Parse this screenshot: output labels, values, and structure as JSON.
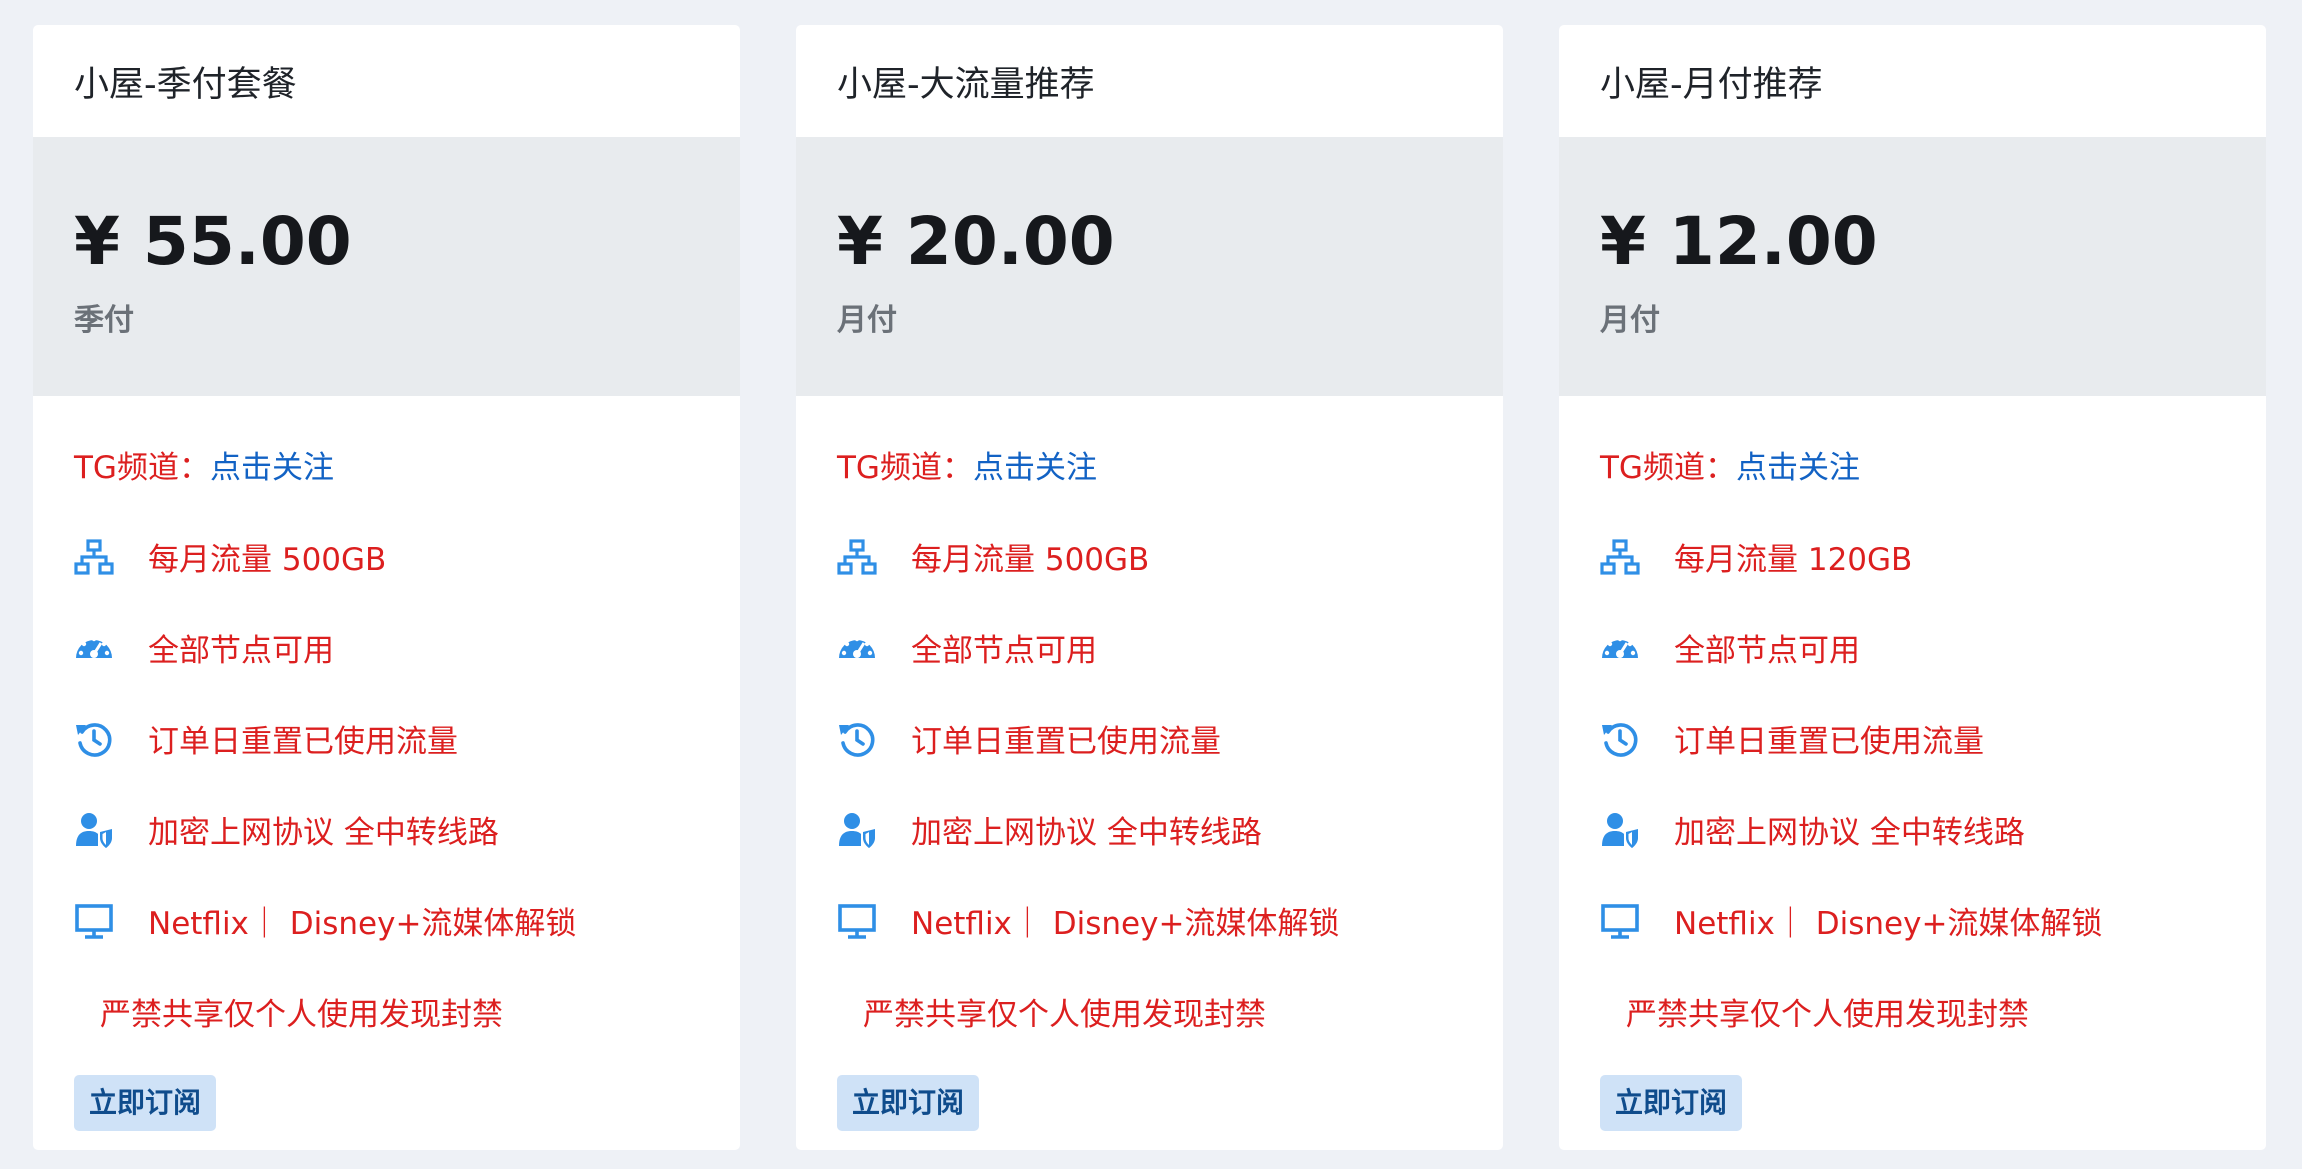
{
  "plans": [
    {
      "title": "小屋-季付套餐",
      "price": "¥ 55.00",
      "period": "季付",
      "tg_label": "TG频道：",
      "tg_link": "点击关注",
      "features": {
        "traffic": "每月流量 500GB",
        "nodes": "全部节点可用",
        "reset": "订单日重置已使用流量",
        "protocol": "加密上网协议 全中转线路",
        "streaming": "Netflix｜ Disney+流媒体解锁",
        "notice": "严禁共享仅个人使用发现封禁"
      },
      "button": "立即订阅"
    },
    {
      "title": "小屋-大流量推荐",
      "price": "¥ 20.00",
      "period": "月付",
      "tg_label": "TG频道：",
      "tg_link": "点击关注",
      "features": {
        "traffic": "每月流量 500GB",
        "nodes": "全部节点可用",
        "reset": "订单日重置已使用流量",
        "protocol": "加密上网协议 全中转线路",
        "streaming": "Netflix｜ Disney+流媒体解锁",
        "notice": "严禁共享仅个人使用发现封禁"
      },
      "button": "立即订阅"
    },
    {
      "title": "小屋-月付推荐",
      "price": "¥ 12.00",
      "period": "月付",
      "tg_label": "TG频道：",
      "tg_link": "点击关注",
      "features": {
        "traffic": "每月流量 120GB",
        "nodes": "全部节点可用",
        "reset": "订单日重置已使用流量",
        "protocol": "加密上网协议 全中转线路",
        "streaming": "Netflix｜ Disney+流媒体解锁",
        "notice": "严禁共享仅个人使用发现封禁"
      },
      "button": "立即订阅"
    }
  ],
  "icons": {
    "traffic": "network-icon",
    "nodes": "speedometer-icon",
    "reset": "history-icon",
    "protocol": "user-shield-icon",
    "streaming": "monitor-icon"
  },
  "colors": {
    "background": "#eef1f6",
    "feature_text": "#dc1f1f",
    "link": "#1262c4",
    "icon": "#2f8fe6",
    "button_bg": "#cfe2f7",
    "button_text": "#0f4c8c"
  }
}
